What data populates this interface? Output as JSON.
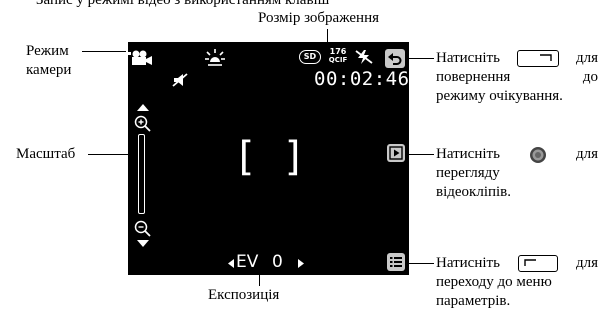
{
  "top_caption": "Запис у режимі відео з використанням клавіш",
  "labels": {
    "image_size": "Розмір зображення",
    "camera_mode_line1": "Режим",
    "camera_mode_line2": "камери",
    "zoom": "Масштаб",
    "exposure": "Експозиція"
  },
  "right_notes": {
    "standby": {
      "word1": "Натисніть",
      "word2": "для",
      "line2a": "повернення",
      "line2b": "до",
      "line3": "режиму очікування."
    },
    "playback": {
      "word1": "Натисніть",
      "word2": "для",
      "line2": "перегляду",
      "line3": "відеокліпів."
    },
    "options": {
      "word1": "Натисніть",
      "word2": "для",
      "line2": "переходу до меню",
      "line3": "параметрів."
    }
  },
  "screen": {
    "storage_badge": "SD",
    "resolution_top": "176",
    "resolution_bottom": "QCIF",
    "timer": "00:02:46",
    "ev_label": "EV",
    "ev_value": "0",
    "focus_left": "[",
    "focus_right": "]"
  },
  "icons": [
    "video-camera-icon",
    "white-balance-icon",
    "mute-icon",
    "no-flash-icon",
    "back-icon",
    "play-icon",
    "menu-icon",
    "zoom-in-icon",
    "zoom-out-icon",
    "arrow-up-icon",
    "arrow-down-icon",
    "arrow-left-icon",
    "arrow-right-icon",
    "navigation-key-icon",
    "right-softkey-icon",
    "left-softkey-icon"
  ]
}
